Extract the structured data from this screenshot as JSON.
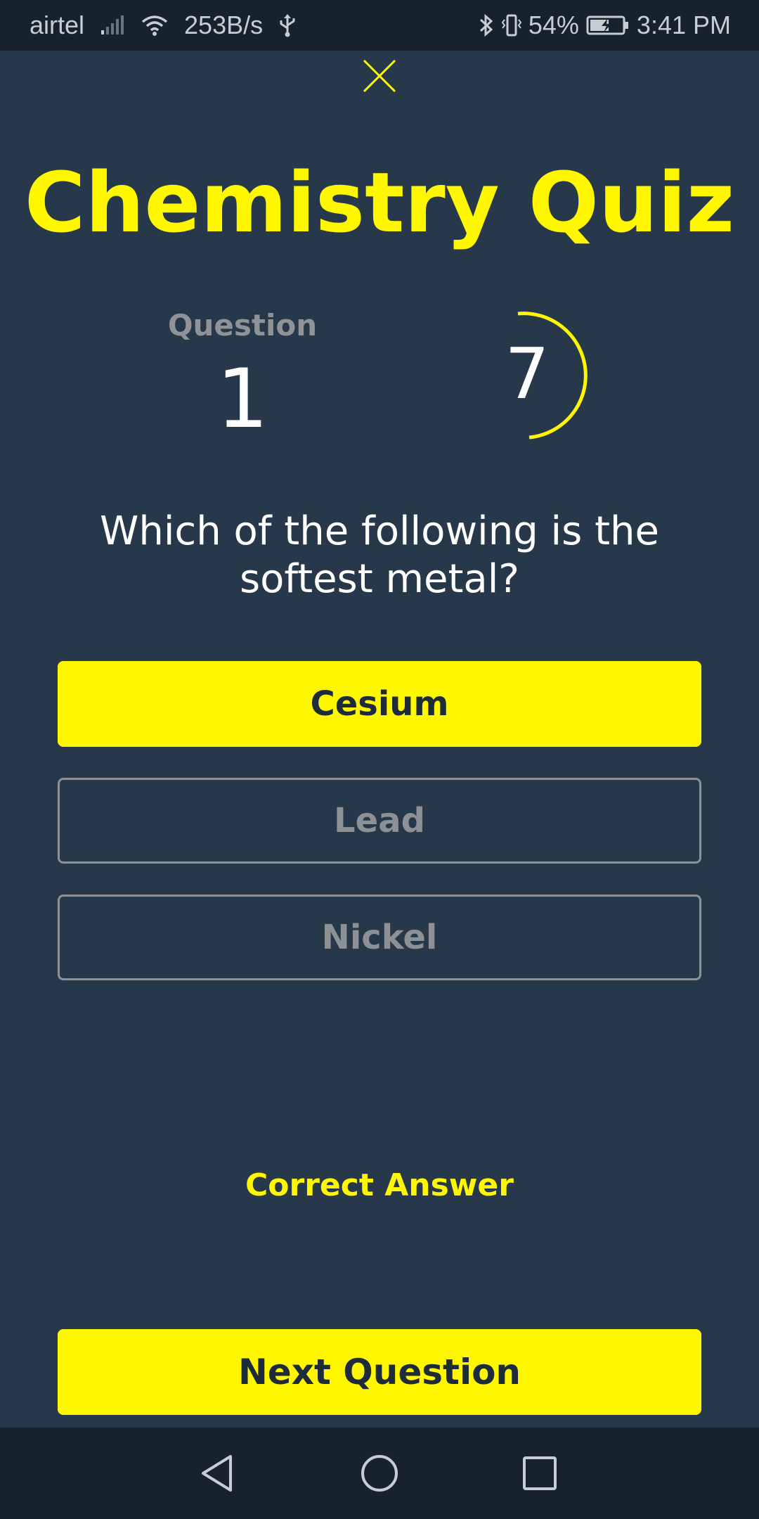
{
  "status_bar": {
    "carrier": "airtel",
    "net_speed": "253B/s",
    "battery": "54%",
    "time": "3:41 PM",
    "icons": [
      "signal-icon",
      "wifi-icon",
      "usb-icon",
      "bluetooth-icon",
      "vibrate-icon",
      "battery-charging-icon"
    ]
  },
  "quiz": {
    "title": "Chemistry Quiz",
    "question_label": "Question",
    "question_number": "1",
    "timer_value": "7",
    "timer_progress": 0.35,
    "question_text": "Which of the following is the softest metal?",
    "answers": [
      {
        "label": "Cesium",
        "state": "selected"
      },
      {
        "label": "Lead",
        "state": "unselected"
      },
      {
        "label": "Nickel",
        "state": "unselected"
      }
    ],
    "result_text": "Correct Answer",
    "next_button_label": "Next Question"
  },
  "nav_bar": {
    "icons": [
      "back-icon",
      "home-icon",
      "recents-icon"
    ]
  },
  "colors": {
    "background": "#263849",
    "accent": "#fff700",
    "muted": "#8d9195",
    "bar": "#16232f"
  }
}
